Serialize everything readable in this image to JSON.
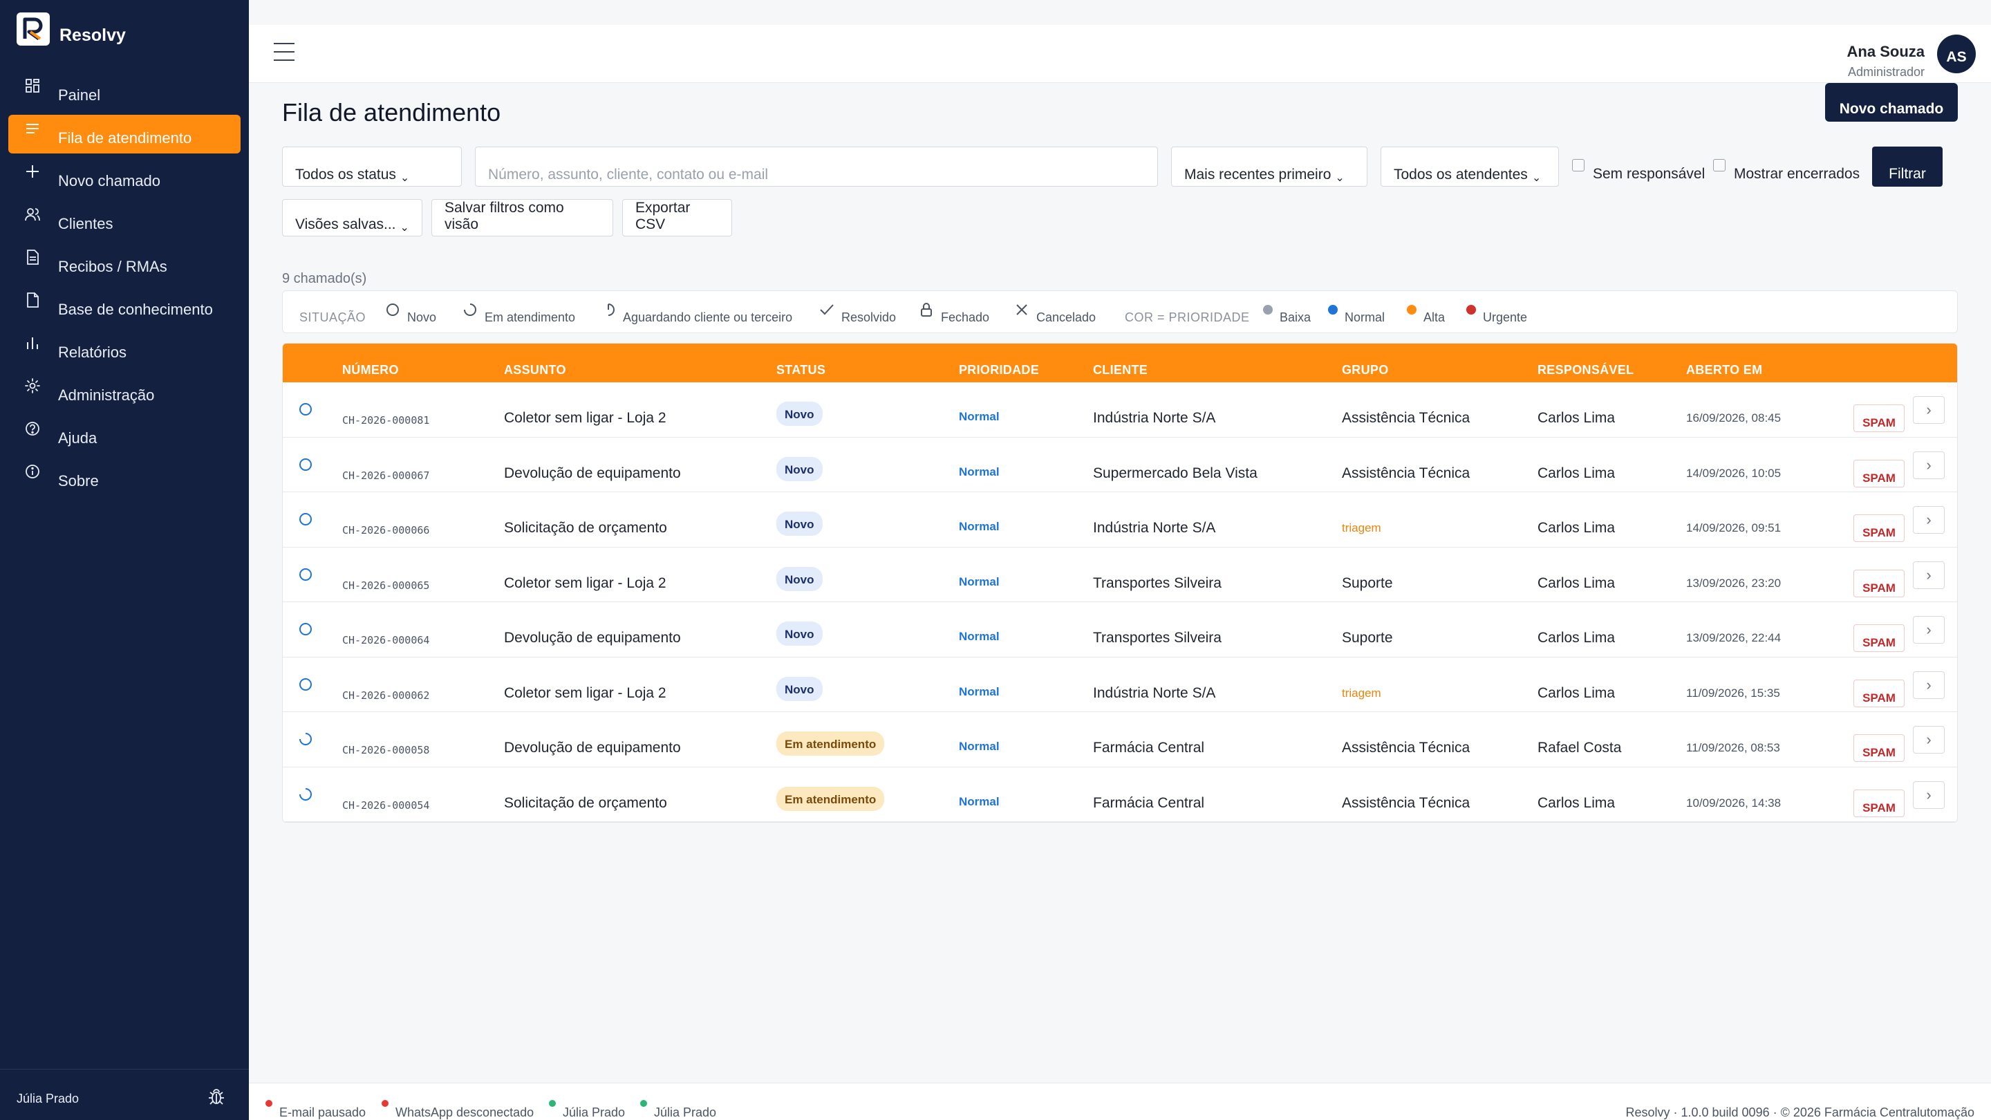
{
  "app": {
    "name": "Resolvy"
  },
  "sidebar": {
    "items": [
      {
        "label": "Painel",
        "icon": "dashboard-icon"
      },
      {
        "label": "Fila de atendimento",
        "icon": "list-icon",
        "active": true
      },
      {
        "label": "Novo chamado",
        "icon": "plus-icon"
      },
      {
        "label": "Clientes",
        "icon": "users-icon"
      },
      {
        "label": "Recibos / RMAs",
        "icon": "document-icon"
      },
      {
        "label": "Base de conhecimento",
        "icon": "page-icon"
      },
      {
        "label": "Relatórios",
        "icon": "bar-chart-icon"
      },
      {
        "label": "Administração",
        "icon": "gear-icon"
      },
      {
        "label": "Ajuda",
        "icon": "help-icon"
      },
      {
        "label": "Sobre",
        "icon": "info-icon"
      }
    ],
    "footer_user": "Júlia Prado"
  },
  "header": {
    "user_name": "Ana Souza",
    "user_role": "Administrador",
    "avatar_initials": "AS"
  },
  "main": {
    "title": "Fila de atendimento",
    "new_ticket_label": "Novo chamado",
    "filters": {
      "status": "Todos os status",
      "search_placeholder": "Número, assunto, cliente, contato ou e-mail",
      "sort": "Mais recentes primeiro",
      "agents": "Todos os atendentes",
      "no_assignee": "Sem responsável",
      "show_closed": "Mostrar encerrados",
      "filter_button": "Filtrar",
      "saved_views": "Visões salvas...",
      "save_view": "Salvar filtros como visão",
      "export_csv": "Exportar CSV"
    },
    "count": "9 chamado(s)",
    "legend": {
      "situation_label": "SITUAÇÃO",
      "situations": [
        "Novo",
        "Em atendimento",
        "Aguardando cliente ou terceiro",
        "Resolvido",
        "Fechado",
        "Cancelado"
      ],
      "priority_label": "COR = PRIORIDADE",
      "priorities": [
        {
          "label": "Baixa",
          "color": "#9aa1ad"
        },
        {
          "label": "Normal",
          "color": "#1e74d9"
        },
        {
          "label": "Alta",
          "color": "#ff8c0f"
        },
        {
          "label": "Urgente",
          "color": "#d32f2f"
        }
      ]
    },
    "table": {
      "headers": [
        "NÚMERO",
        "ASSUNTO",
        "STATUS",
        "PRIORIDADE",
        "CLIENTE",
        "GRUPO",
        "RESPONSÁVEL",
        "ABERTO EM"
      ],
      "spam_label": "SPAM",
      "rows": [
        {
          "number": "CH-2026-000081",
          "subject": "Coletor sem ligar - Loja 2",
          "status": "Novo",
          "priority": "Normal",
          "client": "Indústria Norte S/A",
          "group": "Assistência Técnica",
          "assignee": "Carlos Lima",
          "opened": "16/09/2026, 08:45"
        },
        {
          "number": "CH-2026-000067",
          "subject": "Devolução de equipamento",
          "status": "Novo",
          "priority": "Normal",
          "client": "Supermercado Bela Vista",
          "group": "Assistência Técnica",
          "assignee": "Carlos Lima",
          "opened": "14/09/2026, 10:05"
        },
        {
          "number": "CH-2026-000066",
          "subject": "Solicitação de orçamento",
          "status": "Novo",
          "priority": "Normal",
          "client": "Indústria Norte S/A",
          "group": "triagem",
          "assignee": "Carlos Lima",
          "opened": "14/09/2026, 09:51"
        },
        {
          "number": "CH-2026-000065",
          "subject": "Coletor sem ligar - Loja 2",
          "status": "Novo",
          "priority": "Normal",
          "client": "Transportes Silveira",
          "group": "Suporte",
          "assignee": "Carlos Lima",
          "opened": "13/09/2026, 23:20"
        },
        {
          "number": "CH-2026-000064",
          "subject": "Devolução de equipamento",
          "status": "Novo",
          "priority": "Normal",
          "client": "Transportes Silveira",
          "group": "Suporte",
          "assignee": "Carlos Lima",
          "opened": "13/09/2026, 22:44"
        },
        {
          "number": "CH-2026-000062",
          "subject": "Coletor sem ligar - Loja 2",
          "status": "Novo",
          "priority": "Normal",
          "client": "Indústria Norte S/A",
          "group": "triagem",
          "assignee": "Carlos Lima",
          "opened": "11/09/2026, 15:35"
        },
        {
          "number": "CH-2026-000058",
          "subject": "Devolução de equipamento",
          "status": "Em atendimento",
          "priority": "Normal",
          "client": "Farmácia Central",
          "group": "Assistência Técnica",
          "assignee": "Rafael Costa",
          "opened": "11/09/2026, 08:53"
        },
        {
          "number": "CH-2026-000054",
          "subject": "Solicitação de orçamento",
          "status": "Em atendimento",
          "priority": "Normal",
          "client": "Farmácia Central",
          "group": "Assistência Técnica",
          "assignee": "Carlos Lima",
          "opened": "10/09/2026, 14:38"
        }
      ]
    }
  },
  "footer": {
    "statuses": [
      {
        "label": "E-mail pausado",
        "color": "#e53935"
      },
      {
        "label": "WhatsApp desconectado",
        "color": "#e53935"
      },
      {
        "label": "Júlia Prado",
        "color": "#2bb673"
      },
      {
        "label": "Júlia Prado",
        "color": "#2bb673"
      }
    ],
    "version": "Resolvy · 1.0.0 build 0096 · © 2026 Farmácia Centralutomação"
  },
  "colors": {
    "sidebar_bg": "#13203f",
    "accent": "#ff8c0f",
    "primary_button": "#13203f"
  }
}
